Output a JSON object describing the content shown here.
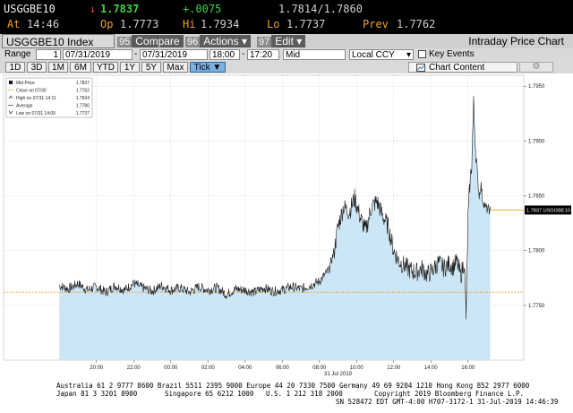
{
  "quote": {
    "ticker": "USGGBE10",
    "direction_arrow": "↓",
    "last_price": "1.7837",
    "change": "+.0075",
    "bid_ask": "1.7814/1.7860",
    "at_label": "At",
    "at_time": "14:46",
    "open_label": "Op",
    "open": "1.7773",
    "high_label": "Hi",
    "high": "1.7934",
    "low_label": "Lo",
    "low": "1.7737",
    "prev_label": "Prev",
    "prev": "1.7762"
  },
  "titlebar": {
    "security": "USGGBE10 Index",
    "compare_num": "95",
    "compare_label": "Compare",
    "actions_num": "96",
    "actions_label": "Actions",
    "edit_num": "97",
    "edit_label": "Edit",
    "dropdown_arrow": "▾",
    "chart_title": "Intraday Price Chart"
  },
  "controls": {
    "range_label": "Range",
    "range_value": "1",
    "start_date": "07/31/2019",
    "separator": "-",
    "end_date": "07/31/2019",
    "start_time": "18:00",
    "end_time": "17:20",
    "price_type": "Mid",
    "currency": "Local CCY",
    "currency_arrow": "▾",
    "key_events_label": "Key Events"
  },
  "periods": {
    "buttons": [
      "1D",
      "3D",
      "1M",
      "6M",
      "YTD",
      "1Y",
      "5Y",
      "Max"
    ],
    "active_label": "Tick ▼",
    "chart_content": "Chart Content",
    "settings_icon": "⚙"
  },
  "colors": {
    "line": "#1a1a1a",
    "area_fill": "#cde6f5",
    "close_line": "#f0a020",
    "last_line": "#f0a020",
    "tag_bg": "#000000",
    "accent_green": "#3fd34a",
    "accent_red": "#f04040",
    "accent_orange": "#f0a020"
  },
  "legend": [
    {
      "text": "Mid Price",
      "value": "1.7837",
      "icon": "solid-square"
    },
    {
      "text": "Close on 07/30",
      "value": "1.7762",
      "icon": "dashed-orange"
    },
    {
      "text": "High on 07/31 14:11",
      "value": "1.7934",
      "icon": "caret-up"
    },
    {
      "text": "Average",
      "value": "1.7780",
      "icon": "line"
    },
    {
      "text": "Low on 07/31 14:00",
      "value": "1.7737",
      "icon": "caret-down"
    }
  ],
  "chart_data": {
    "type": "area",
    "x_unit": "hours since 18:00 on 07/30 (axis labels show clock time)",
    "ylim": [
      1.77,
      1.796
    ],
    "xlim": [
      -3,
      25
    ],
    "x_ticks": [
      "20:00",
      "22:00",
      "00:00",
      "02:00",
      "04:00",
      "06:00",
      "08:00",
      "10:00",
      "12:00",
      "14:00",
      "16:00"
    ],
    "date_label": "31 Jul 2019",
    "y_ticks": [
      "1.7950",
      "1.7900",
      "1.7850",
      "1.7800",
      "1.7750"
    ],
    "last_tag": "1.7837 USGGBE10",
    "last_value": 1.7837,
    "prev_close": 1.7762,
    "series": [
      {
        "points": [
          [
            0.0,
            1.7768
          ],
          [
            0.5,
            1.7765
          ],
          [
            1.0,
            1.777
          ],
          [
            1.5,
            1.7764
          ],
          [
            2.0,
            1.7767
          ],
          [
            2.5,
            1.7762
          ],
          [
            3.0,
            1.7768
          ],
          [
            3.5,
            1.7764
          ],
          [
            4.0,
            1.777
          ],
          [
            4.5,
            1.7766
          ],
          [
            5.0,
            1.7763
          ],
          [
            5.5,
            1.7768
          ],
          [
            6.0,
            1.7764
          ],
          [
            6.5,
            1.7766
          ],
          [
            7.0,
            1.7762
          ],
          [
            7.5,
            1.7767
          ],
          [
            8.0,
            1.7764
          ],
          [
            8.5,
            1.7766
          ],
          [
            9.0,
            1.776
          ],
          [
            9.5,
            1.7765
          ],
          [
            10.0,
            1.7764
          ],
          [
            10.5,
            1.7762
          ],
          [
            11.0,
            1.7766
          ],
          [
            11.5,
            1.7763
          ],
          [
            12.0,
            1.7764
          ],
          [
            12.5,
            1.7767
          ],
          [
            13.0,
            1.7765
          ],
          [
            13.5,
            1.7768
          ],
          [
            14.0,
            1.7772
          ],
          [
            14.5,
            1.7782
          ],
          [
            14.8,
            1.78
          ],
          [
            15.0,
            1.7822
          ],
          [
            15.3,
            1.784
          ],
          [
            15.6,
            1.7835
          ],
          [
            15.9,
            1.7848
          ],
          [
            16.2,
            1.783
          ],
          [
            16.5,
            1.7818
          ],
          [
            16.8,
            1.784
          ],
          [
            17.1,
            1.7845
          ],
          [
            17.4,
            1.7832
          ],
          [
            17.7,
            1.7822
          ],
          [
            18.0,
            1.78
          ],
          [
            18.3,
            1.779
          ],
          [
            18.6,
            1.7786
          ],
          [
            18.9,
            1.7782
          ],
          [
            19.2,
            1.778
          ],
          [
            19.5,
            1.7784
          ],
          [
            19.8,
            1.7778
          ],
          [
            20.1,
            1.7782
          ],
          [
            20.4,
            1.7789
          ],
          [
            20.7,
            1.7784
          ],
          [
            21.0,
            1.7788
          ],
          [
            21.2,
            1.7785
          ],
          [
            21.4,
            1.779
          ],
          [
            21.6,
            1.7777
          ],
          [
            21.8,
            1.779
          ],
          [
            21.9,
            1.774
          ],
          [
            22.0,
            1.783
          ],
          [
            22.1,
            1.786
          ],
          [
            22.2,
            1.788
          ],
          [
            22.3,
            1.7934
          ],
          [
            22.4,
            1.7895
          ],
          [
            22.5,
            1.787
          ],
          [
            22.6,
            1.785
          ],
          [
            22.7,
            1.786
          ],
          [
            22.8,
            1.7845
          ],
          [
            23.0,
            1.7838
          ],
          [
            23.2,
            1.7837
          ]
        ]
      }
    ]
  },
  "footer": {
    "line1": "Australia 61 2 9777 8600 Brazil 5511 2395 9000 Europe 44 20 7330 7500 Germany 49 69 9204 1210 Hong Kong 852 2977 6000",
    "line2a": "Japan 81 3 3201 8900",
    "line2b": "Singapore 65 6212 1000",
    "line2c": "U.S. 1 212 318 2000",
    "line2d": "Copyright 2019 Bloomberg Finance L.P.",
    "line3": "SN 528472 EDT  GMT-4:00 H707-3172-1 31-Jul-2019 14:46:39"
  }
}
